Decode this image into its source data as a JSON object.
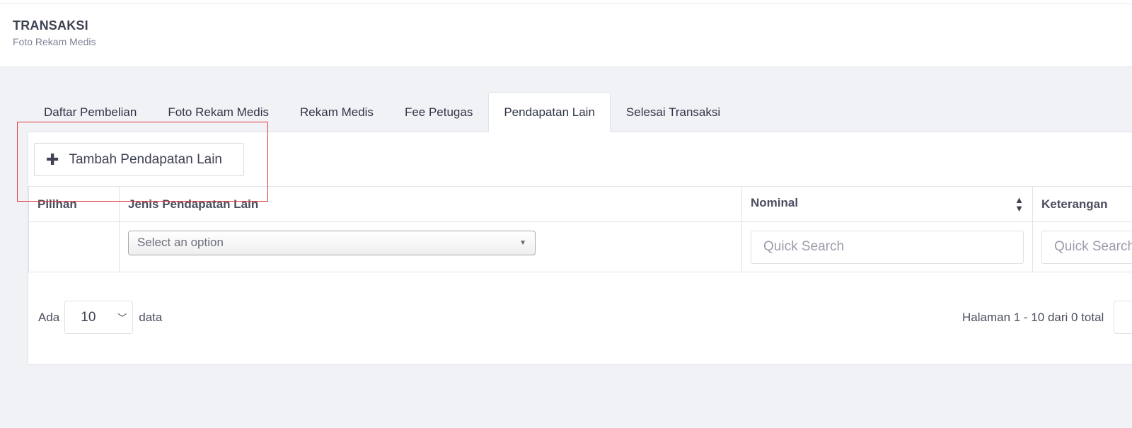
{
  "header": {
    "title": "TRANSAKSI",
    "subtitle": "Foto Rekam Medis"
  },
  "tabs": [
    {
      "label": "Daftar Pembelian",
      "active": false
    },
    {
      "label": "Foto Rekam Medis",
      "active": false
    },
    {
      "label": "Rekam Medis",
      "active": false
    },
    {
      "label": "Fee Petugas",
      "active": false
    },
    {
      "label": "Pendapatan Lain",
      "active": true
    },
    {
      "label": "Selesai Transaksi",
      "active": false
    }
  ],
  "toolbar": {
    "add_label": "Tambah Pendapatan Lain",
    "add_icon": "plus-icon"
  },
  "table": {
    "columns": [
      "Pilihan",
      "Jenis Pendapatan Lain",
      "Nominal",
      "Keterangan"
    ],
    "filters": {
      "jenis_placeholder": "Select an option",
      "nominal_placeholder": "Quick Search",
      "keterangan_placeholder": "Quick Search"
    }
  },
  "footer": {
    "show_prefix": "Ada",
    "page_size": "10",
    "show_suffix": "data",
    "page_info": "Halaman 1 - 10 dari 0 total"
  },
  "colors": {
    "highlight_border": "#e0393e",
    "background": "#f1f2f6"
  }
}
